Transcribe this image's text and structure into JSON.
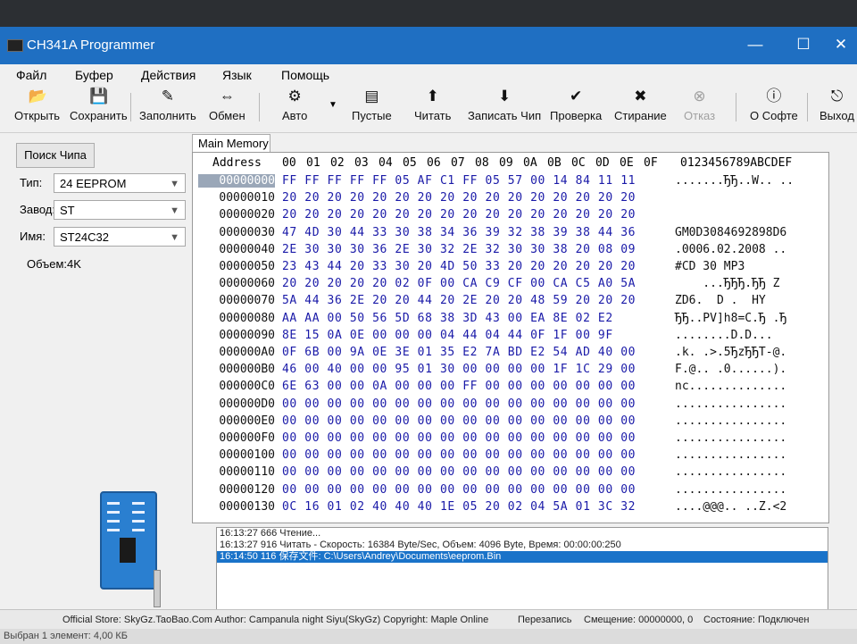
{
  "window": {
    "title": "CH341A Programmer",
    "minimize": "—",
    "maximize": "☐",
    "close": "✕"
  },
  "menu": [
    "Файл",
    "Буфер",
    "Действия",
    "Язык",
    "Помощь"
  ],
  "toolbar": [
    {
      "label": "Открыть",
      "icon": "folder-open-icon",
      "glyph": "📂"
    },
    {
      "label": "Сохранить",
      "icon": "save-icon",
      "glyph": "💾"
    },
    {
      "label": "Заполнить",
      "icon": "fill-icon",
      "glyph": "✎"
    },
    {
      "label": "Обмен",
      "icon": "swap-icon",
      "glyph": "⇔"
    },
    {
      "label": "Авто",
      "icon": "auto-icon",
      "glyph": "⚙"
    },
    {
      "label": "Пустые",
      "icon": "blank-check-icon",
      "glyph": "▤"
    },
    {
      "label": "Читать",
      "icon": "read-icon",
      "glyph": "⬆"
    },
    {
      "label": "Записать Чип",
      "icon": "write-icon",
      "glyph": "⬇"
    },
    {
      "label": "Проверка",
      "icon": "verify-icon",
      "glyph": "✔"
    },
    {
      "label": "Стирание",
      "icon": "erase-icon",
      "glyph": "✖"
    },
    {
      "label": "Отказ",
      "icon": "cancel-icon",
      "glyph": "⊗"
    },
    {
      "label": "О Софте",
      "icon": "info-icon",
      "glyph": "ⓘ"
    },
    {
      "label": "Выход",
      "icon": "exit-icon",
      "glyph": "⎋"
    }
  ],
  "left": {
    "search_button": "Поиск Чипа",
    "type_label": "Тип:",
    "type_value": "24 EEPROM",
    "maker_label": "Завод:",
    "maker_value": "ST",
    "name_label": "Имя:",
    "name_value": "ST24C32",
    "size_label": "Объем:4K",
    "progress": "0%"
  },
  "tab": "Main Memory",
  "hex": {
    "address_header": "Address",
    "col_headers": [
      "00",
      "01",
      "02",
      "03",
      "04",
      "05",
      "06",
      "07",
      "08",
      "09",
      "0A",
      "0B",
      "0C",
      "0D",
      "0E",
      "0F"
    ],
    "ascii_header": "0123456789ABCDEF",
    "rows": [
      {
        "addr": "00000000",
        "bytes": "FF FF FF FF FF 05 AF C1 FF 05 57 00 14 84 11 11",
        "ascii": ".......ЂЂ..W.. .."
      },
      {
        "addr": "00000010",
        "bytes": "20 20 20 20 20 20 20 20 20 20 20 20 20 20 20 20",
        "ascii": ""
      },
      {
        "addr": "00000020",
        "bytes": "20 20 20 20 20 20 20 20 20 20 20 20 20 20 20 20",
        "ascii": ""
      },
      {
        "addr": "00000030",
        "bytes": "47 4D 30 44 33 30 38 34 36 39 32 38 39 38 44 36",
        "ascii": "GM0D3084692898D6"
      },
      {
        "addr": "00000040",
        "bytes": "2E 30 30 30 36 2E 30 32 2E 32 30 30 38 20 08 09",
        "ascii": ".0006.02.2008 .."
      },
      {
        "addr": "00000050",
        "bytes": "23 43 44 20 33 30 20 4D 50 33 20 20 20 20 20 20",
        "ascii": "#CD 30 MP3"
      },
      {
        "addr": "00000060",
        "bytes": "20 20 20 20 20 02 0F 00 CA C9 CF 00 CA C5 A0 5A",
        "ascii": "    ...ЂЂЂ.ЂЂ Z"
      },
      {
        "addr": "00000070",
        "bytes": "5A 44 36 2E 20 20 44 20 2E 20 20 48 59 20 20 20",
        "ascii": "ZD6.  D .  HY"
      },
      {
        "addr": "00000080",
        "bytes": "AA AA 00 50 56 5D 68 38 3D 43 00 EA 8E 02 E2",
        "ascii": "ЂЂ..PV]h8=C.Ђ .Ђ"
      },
      {
        "addr": "00000090",
        "bytes": "8E 15 0A 0E 00 00 00 04 44 04 44 0F 1F 00 9F",
        "ascii": "........D.D..."
      },
      {
        "addr": "000000A0",
        "bytes": "0F 6B 00 9A 0E 3E 01 35 E2 7A BD E2 54 AD 40 00",
        "ascii": ".k. .>.5ЂzЂЂT-@."
      },
      {
        "addr": "000000B0",
        "bytes": "46 00 40 00 00 95 01 30 00 00 00 00 1F 1C 29 00",
        "ascii": "F.@.. .0......)."
      },
      {
        "addr": "000000C0",
        "bytes": "6E 63 00 00 0A 00 00 00 FF 00 00 00 00 00 00 00",
        "ascii": "nc.............."
      },
      {
        "addr": "000000D0",
        "bytes": "00 00 00 00 00 00 00 00 00 00 00 00 00 00 00 00",
        "ascii": "................"
      },
      {
        "addr": "000000E0",
        "bytes": "00 00 00 00 00 00 00 00 00 00 00 00 00 00 00 00",
        "ascii": "................"
      },
      {
        "addr": "000000F0",
        "bytes": "00 00 00 00 00 00 00 00 00 00 00 00 00 00 00 00",
        "ascii": "................"
      },
      {
        "addr": "00000100",
        "bytes": "00 00 00 00 00 00 00 00 00 00 00 00 00 00 00 00",
        "ascii": "................"
      },
      {
        "addr": "00000110",
        "bytes": "00 00 00 00 00 00 00 00 00 00 00 00 00 00 00 00",
        "ascii": "................"
      },
      {
        "addr": "00000120",
        "bytes": "00 00 00 00 00 00 00 00 00 00 00 00 00 00 00 00",
        "ascii": "................"
      },
      {
        "addr": "00000130",
        "bytes": "0C 16 01 02 40 40 40 1E 05 20 02 04 5A 01 3C 32",
        "ascii": "....@@@.. ..Z.<2"
      }
    ]
  },
  "log": [
    {
      "text": "16:13:27 666 Чтение..."
    },
    {
      "text": "16:13:27 916 Читать - Скорость: 16384 Byte/Sec, Объем: 4096 Byte, Время: 00:00:00:250"
    },
    {
      "text": "16:14:50 116 保存文件: C:\\Users\\Andrey\\Documents\\eeprom.Bin"
    }
  ],
  "status": {
    "credits": "Official Store: SkyGz.TaoBao.Com Author: Campanula night Siyu(SkyGz) Copyright: Maple Online",
    "mode": "Перезапись",
    "offset": "Смещение: 00000000, 0",
    "state": "Состояние: Подключен"
  },
  "explorer_status": "Выбран 1 элемент: 4,00 КБ"
}
